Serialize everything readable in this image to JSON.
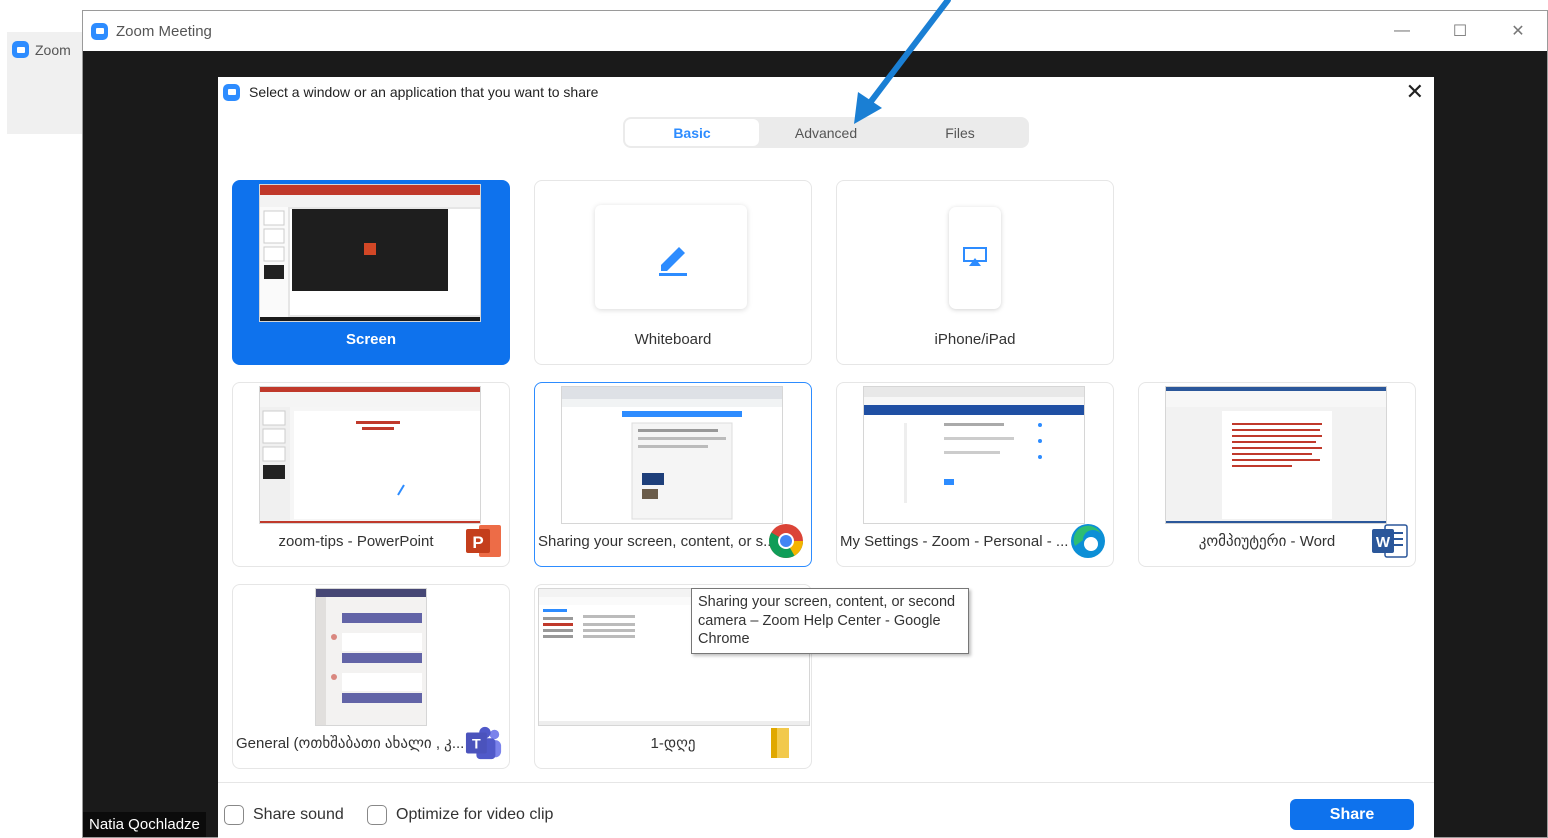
{
  "background": {
    "tab_label": "Zoom"
  },
  "window": {
    "title": "Zoom Meeting",
    "controls": [
      "minimize",
      "maximize",
      "close"
    ]
  },
  "participant": {
    "name": "Natia Qochladze"
  },
  "dialog": {
    "header": "Select a window or an application that you want to share",
    "tabs": [
      {
        "label": "Basic",
        "active": true
      },
      {
        "label": "Advanced",
        "active": false
      },
      {
        "label": "Files",
        "active": false
      }
    ],
    "tiles": [
      {
        "label": "Screen",
        "selected": true
      },
      {
        "label": "Whiteboard"
      },
      {
        "label": "iPhone/iPad"
      },
      {
        "label": "zoom-tips - PowerPoint",
        "app_icon": "powerpoint-icon"
      },
      {
        "label": "Sharing your screen, content, or s...",
        "app_icon": "chrome-icon",
        "hovered": true
      },
      {
        "label": "My Settings - Zoom - Personal - ...",
        "app_icon": "edge-icon"
      },
      {
        "label": "კომპიუტერი - Word",
        "app_icon": "word-icon"
      },
      {
        "label": "General (ოთხშაბათი ახალი , კ...",
        "app_icon": "teams-icon"
      },
      {
        "label": "1-დღე",
        "app_icon": "folder-icon"
      }
    ],
    "tooltip": "Sharing your screen, content, or second camera – Zoom Help Center - Google Chrome",
    "share_sound_label": "Share sound",
    "optimize_label": "Optimize for video clip",
    "share_button": "Share"
  },
  "colors": {
    "accent": "#0e72ed",
    "zoom_blue": "#2d8cff",
    "annotation_arrow": "#1a7fd4"
  }
}
